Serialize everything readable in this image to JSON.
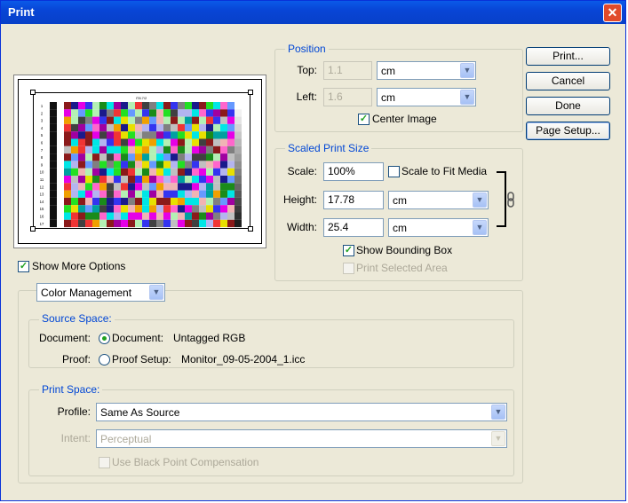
{
  "window": {
    "title": "Print",
    "close_glyph": "✕"
  },
  "buttons": {
    "print": "Print...",
    "cancel": "Cancel",
    "done": "Done",
    "page_setup": "Page Setup..."
  },
  "position": {
    "title": "Position",
    "top_label": "Top:",
    "top_value": "1.1",
    "top_unit": "cm",
    "left_label": "Left:",
    "left_value": "1.6",
    "left_unit": "cm",
    "center_image_label": "Center Image",
    "center_image_checked": true
  },
  "scaled": {
    "title": "Scaled Print Size",
    "scale_label": "Scale:",
    "scale_value": "100%",
    "fit_media_label": "Scale to Fit Media",
    "height_label": "Height:",
    "height_value": "17.78",
    "height_unit": "cm",
    "width_label": "Width:",
    "width_value": "25.4",
    "width_unit": "cm",
    "bounding_box_label": "Show Bounding Box",
    "print_selected_label": "Print Selected Area"
  },
  "preview": {
    "target_label": "IT8.7/2",
    "rows": [
      "1",
      "2",
      "3",
      "4",
      "5",
      "6",
      "7",
      "8",
      "9",
      "10",
      "11",
      "12",
      "13",
      "14",
      "15",
      "16",
      "17"
    ],
    "columns": [
      "A",
      "B",
      "C",
      "D",
      "E",
      "F",
      "G",
      "H",
      "I",
      "J",
      "K",
      "L",
      "M",
      "N",
      "O",
      "P",
      "Q",
      "R",
      "S",
      "T",
      "U",
      "V",
      "W",
      "X",
      "Y",
      "Z",
      "AA"
    ],
    "palette": [
      "#e8e000",
      "#00e6e6",
      "#e600e6",
      "#22e022",
      "#3434f0",
      "#f03434",
      "#f0b4b4",
      "#b4b4f0",
      "#b4f0b4",
      "#8b1a1a",
      "#1a8b1a",
      "#1a1a8b",
      "#f0a000",
      "#808080",
      "#c0c0c0",
      "#404040",
      "#00a0a0",
      "#a000a0",
      "#ff66cc",
      "#6699ff"
    ]
  },
  "show_more": {
    "label": "Show More Options",
    "checked": true
  },
  "color_mgmt": {
    "dropdown_value": "Color Management",
    "source_title": "Source Space:",
    "document_label": "Document:",
    "document_option": "Document:",
    "document_profile": "Untagged RGB",
    "proof_label": "Proof:",
    "proof_option": "Proof Setup:",
    "proof_profile": "Monitor_09-05-2004_1.icc",
    "print_title": "Print Space:",
    "profile_label": "Profile:",
    "profile_value": "Same As Source",
    "intent_label": "Intent:",
    "intent_value": "Perceptual",
    "bpc_label": "Use Black Point Compensation"
  },
  "icons": {
    "checkmark": "✓",
    "dropdown_arrow": "▼"
  }
}
